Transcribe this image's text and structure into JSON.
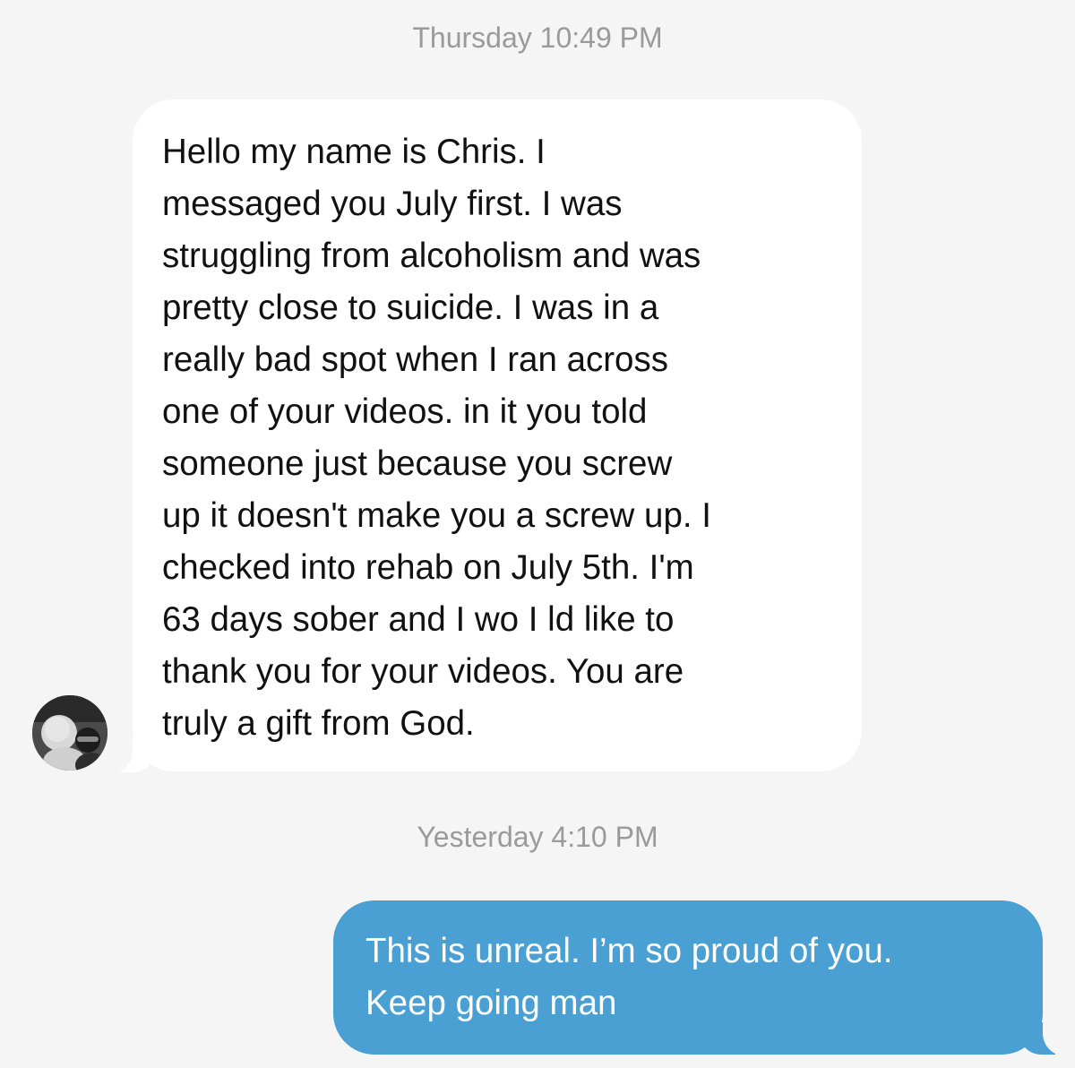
{
  "conversation": {
    "timestamps": [
      "Thursday 10:49 PM",
      "Yesterday 4:10 PM"
    ],
    "messages": [
      {
        "direction": "incoming",
        "text": "Hello my name is Chris.  I\nmessaged you July first. I was\nstruggling from alcoholism and was\npretty close to suicide.  I was in a\nreally bad spot when I ran across\none of your videos. in it you told\nsomeone just because you screw\nup it doesn't make you a screw up. I\nchecked into rehab on July 5th. I'm\n63 days sober and I wo I ld like to\nthank you for your videos.  You are\ntruly a gift from God."
      },
      {
        "direction": "outgoing",
        "text": "This is unreal. I’m so proud of you.\nKeep going man"
      }
    ]
  },
  "colors": {
    "background": "#f5f5f5",
    "incoming_bubble": "#ffffff",
    "outgoing_bubble": "#4a9fd3",
    "timestamp_text": "#9a9a9a"
  },
  "icons": {
    "avatar": "sender-avatar-photo"
  }
}
